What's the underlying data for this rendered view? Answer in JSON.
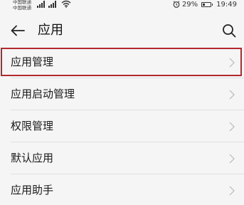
{
  "status_bar": {
    "carrier_1": "中国联通",
    "carrier_2": "中国联通",
    "battery_percent": "29%",
    "battery_level": 0.29,
    "time": "19:49",
    "icons": [
      "signal-icon",
      "signal-icon",
      "wifi-icon",
      "alarm-icon",
      "battery-icon"
    ]
  },
  "app_bar": {
    "title": "应用",
    "back_icon": "back-arrow-icon",
    "search_icon": "search-icon"
  },
  "menu": {
    "items": [
      {
        "label": "应用管理",
        "highlighted": true
      },
      {
        "label": "应用启动管理",
        "highlighted": false
      },
      {
        "label": "权限管理",
        "highlighted": false
      },
      {
        "label": "默认应用",
        "highlighted": false
      },
      {
        "label": "应用助手",
        "highlighted": false
      }
    ],
    "highlight_color": "#b3282d"
  }
}
